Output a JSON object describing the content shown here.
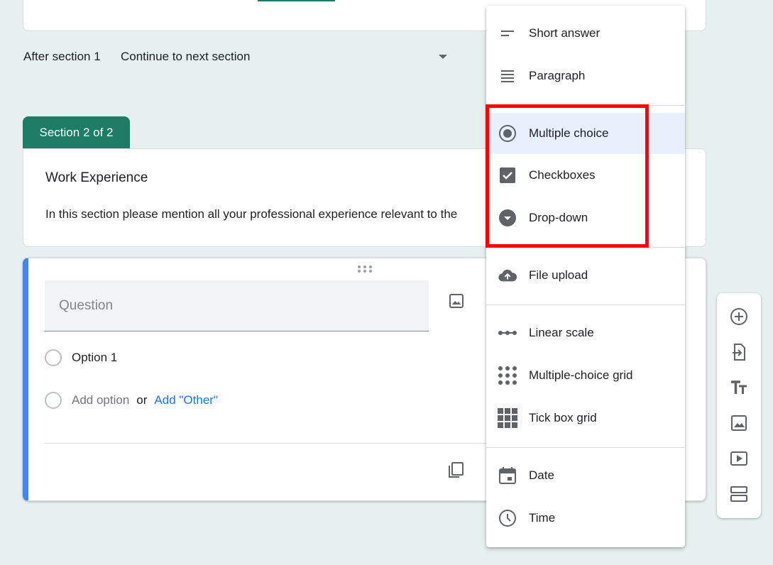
{
  "top": {
    "after_section_label": "After section 1",
    "after_section_value": "Continue to next section"
  },
  "section": {
    "tab_label": "Section 2 of 2",
    "title": "Work Experience",
    "description": "In this section please mention all your professional experience relevant to the"
  },
  "question": {
    "placeholder": "Question",
    "option_1": "Option 1",
    "add_option": "Add option",
    "or_text": "or",
    "add_other": "Add \"Other\""
  },
  "type_menu": {
    "items": [
      {
        "label": "Short answer",
        "icon": "short-answer-icon"
      },
      {
        "label": "Paragraph",
        "icon": "paragraph-icon"
      },
      {
        "label": "Multiple choice",
        "icon": "radio-checked-icon",
        "selected": true
      },
      {
        "label": "Checkboxes",
        "icon": "checkbox-icon"
      },
      {
        "label": "Drop-down",
        "icon": "dropdown-circle-icon"
      },
      {
        "label": "File upload",
        "icon": "cloud-upload-icon"
      },
      {
        "label": "Linear scale",
        "icon": "linear-scale-icon"
      },
      {
        "label": "Multiple-choice grid",
        "icon": "dot-grid-icon"
      },
      {
        "label": "Tick box grid",
        "icon": "square-grid-icon"
      },
      {
        "label": "Date",
        "icon": "calendar-icon"
      },
      {
        "label": "Time",
        "icon": "clock-icon"
      }
    ]
  },
  "side_toolbar": [
    "add-question-icon",
    "import-questions-icon",
    "add-title-icon",
    "add-image-icon",
    "add-video-icon",
    "add-section-icon"
  ],
  "colors": {
    "accent": "#1e7c66",
    "question_border": "#4285f4",
    "highlight": "#ff0000",
    "link": "#1a73e8",
    "background": "#e6f0ee"
  }
}
